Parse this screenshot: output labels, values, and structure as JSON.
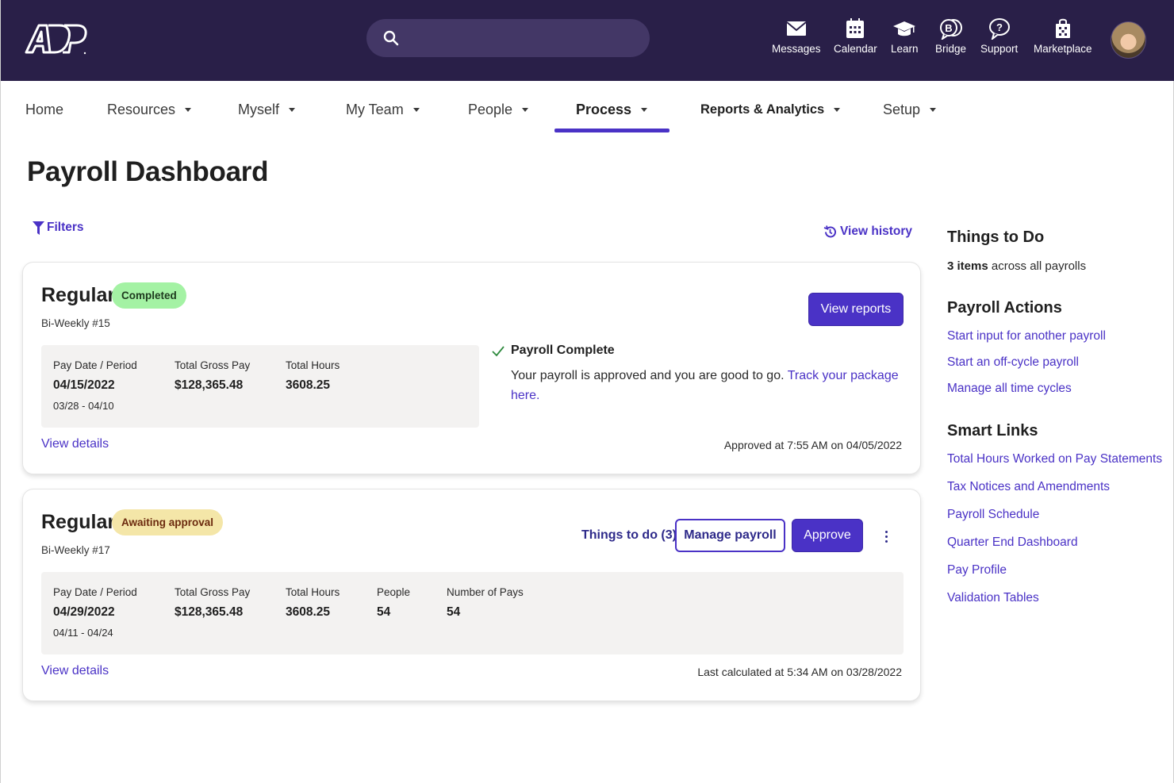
{
  "header": {
    "logo": "ADP",
    "search": {
      "placeholder": "",
      "value": ""
    },
    "utilities": [
      {
        "label": "Messages",
        "icon": "envelope-icon"
      },
      {
        "label": "Calendar",
        "icon": "calendar-icon"
      },
      {
        "label": "Learn",
        "icon": "graduation-cap-icon"
      },
      {
        "label": "Bridge",
        "icon": "bridge-chat-icon"
      },
      {
        "label": "Support",
        "icon": "question-bubble-icon"
      },
      {
        "label": "Marketplace",
        "icon": "shopping-bag-icon"
      }
    ],
    "avatar": "user-avatar"
  },
  "nav": {
    "items": [
      {
        "label": "Home",
        "dropdown": false
      },
      {
        "label": "Resources",
        "dropdown": true
      },
      {
        "label": "Myself",
        "dropdown": true
      },
      {
        "label": "My Team",
        "dropdown": true
      },
      {
        "label": "People",
        "dropdown": true
      },
      {
        "label": "Process",
        "dropdown": true,
        "active": true
      },
      {
        "label": "Reports & Analytics",
        "dropdown": true
      },
      {
        "label": "Setup",
        "dropdown": true
      }
    ]
  },
  "page": {
    "title": "Payroll Dashboard",
    "filters_label": "Filters",
    "view_history_label": "View history"
  },
  "payrolls": [
    {
      "title": "Regular",
      "status": "Completed",
      "subtitle": "Bi-Weekly #15",
      "primary_action": "View reports",
      "stats": [
        {
          "label": "Pay Date / Period",
          "value": "04/15/2022",
          "period": "03/28 - 04/10"
        },
        {
          "label": "Total Gross Pay",
          "value": "$128,365.48"
        },
        {
          "label": "Total Hours",
          "value": "3608.25"
        }
      ],
      "message": {
        "title": "Payroll Complete",
        "text": "Your payroll is approved and you are good to go. ",
        "link": "Track your package here."
      },
      "view_details": "View details",
      "meta": "Approved at 7:55 AM on 04/05/2022"
    },
    {
      "title": "Regular",
      "status": "Awaiting approval",
      "subtitle": "Bi-Weekly #17",
      "things_to_do": "Things to do (3)",
      "secondary_action": "Manage payroll",
      "primary_action": "Approve",
      "stats": [
        {
          "label": "Pay Date / Period",
          "value": "04/29/2022",
          "period": "04/11 - 04/24"
        },
        {
          "label": "Total Gross Pay",
          "value": "$128,365.48"
        },
        {
          "label": "Total Hours",
          "value": "3608.25"
        },
        {
          "label": "People",
          "value": "54"
        },
        {
          "label": "Number of Pays",
          "value": "54"
        }
      ],
      "view_details": "View details",
      "meta": "Last calculated at 5:34 AM on 03/28/2022"
    }
  ],
  "sidebar": {
    "things_to_do": {
      "heading": "Things to Do",
      "count": "3 items",
      "suffix": " across all payrolls"
    },
    "payroll_actions": {
      "heading": "Payroll Actions",
      "links": [
        "Start input for another payroll",
        "Start an off-cycle payroll",
        "Manage all time cycles"
      ]
    },
    "smart_links": {
      "heading": "Smart Links",
      "links": [
        "Total Hours Worked on Pay Statements",
        "Tax Notices and Amendments",
        "Payroll Schedule",
        "Quarter End Dashboard",
        "Pay Profile",
        "Validation Tables"
      ]
    }
  },
  "colors": {
    "header_bg": "#291f48",
    "search_bg": "#433766",
    "accent": "#4a32c6",
    "completed_badge": "#a4f2a4",
    "awaiting_badge": "#f4e6a8",
    "stats_bg": "#f3f2f1"
  }
}
